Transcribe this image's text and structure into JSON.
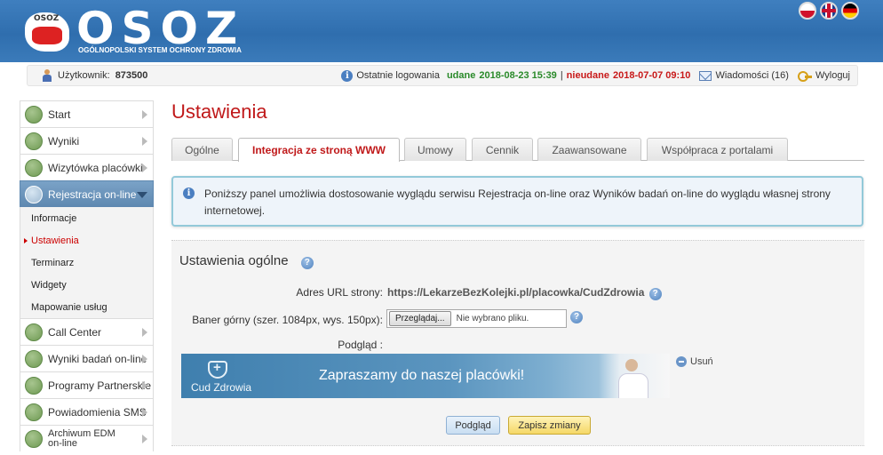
{
  "header": {
    "logo_small": "OSOZ",
    "logo_word": "OSOZ",
    "logo_subtitle": "OGÓLNOPOLSKI SYSTEM OCHRONY ZDROWIA",
    "flags": [
      "flag-pl-icon",
      "flag-en-icon",
      "flag-de-icon"
    ]
  },
  "userbar": {
    "user_label": "Użytkownik:",
    "user_id": "873500",
    "last_logins_label": "Ostatnie logowania",
    "success_label": "udane",
    "success_time": "2018-08-23 15:39",
    "separator": "|",
    "failed_label": "nieudane",
    "failed_time": "2018-07-07 09:10",
    "messages_label": "Wiadomości (16)",
    "logout_label": "Wyloguj"
  },
  "sidebar": {
    "items_top": [
      {
        "label": "Start",
        "icon": "monitor-icon"
      },
      {
        "label": "Wyniki",
        "icon": "bar-chart-icon"
      },
      {
        "label": "Wizytówka placówki",
        "icon": "globe-icon"
      },
      {
        "label": "Rejestracja on-line",
        "icon": "calendar-icon"
      }
    ],
    "subitems": [
      "Informacje",
      "Ustawienia",
      "Terminarz",
      "Widgety",
      "Mapowanie usług"
    ],
    "items_bottom": [
      {
        "label": "Call Center",
        "icon": "phone-icon"
      },
      {
        "label": "Wyniki badań on-line",
        "icon": "flask-icon"
      },
      {
        "label": "Programy Partnerskie",
        "icon": "handshake-icon"
      },
      {
        "label": "Powiadomienia SMS",
        "icon": "sms-icon"
      },
      {
        "label_1": "Archiwum EDM",
        "label_2": "on-line",
        "icon": "archive-icon"
      }
    ]
  },
  "main": {
    "title": "Ustawienia",
    "tabs": [
      "Ogólne",
      "Integracja ze stroną WWW",
      "Umowy",
      "Cennik",
      "Zaawansowane",
      "Współpraca z portalami"
    ],
    "notice": "Poniższy panel umożliwia dostosowanie wyglądu serwisu Rejestracja on-line oraz Wyników badań on-line do wyglądu własnej strony internetowej.",
    "panel": {
      "title": "Ustawienia ogólne",
      "url_label": "Adres URL strony:",
      "url_value": "https://LekarzeBezKolejki.pl/placowka/CudZdrowia",
      "banner_label": "Baner górny (szer. 1084px, wys. 150px):",
      "browse_button": "Przeglądaj...",
      "no_file": "Nie wybrano pliku.",
      "preview_label": "Podgląd :",
      "banner_brand": "Cud Zdrowia",
      "banner_slogan": "Zapraszamy do naszej placówki!",
      "remove_label": "Usuń",
      "preview_button": "Podgląd",
      "save_button": "Zapisz zmiany"
    }
  },
  "colors": {
    "header_blue": "#2f6eae",
    "title_red": "#c0191a",
    "success_green": "#2a8a2a",
    "fail_red": "#c81919",
    "active_menu": "#6a93ba"
  }
}
